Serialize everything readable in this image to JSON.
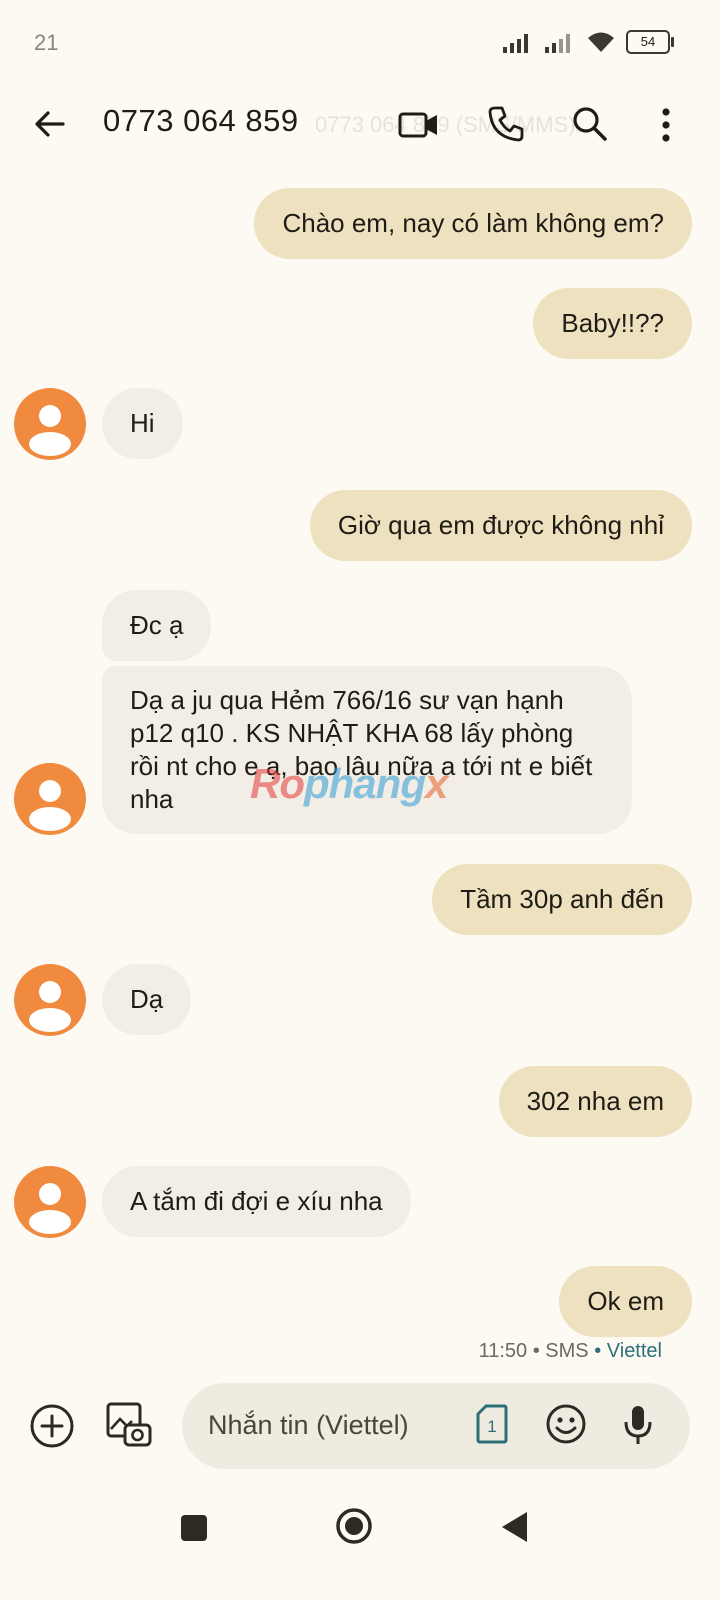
{
  "status_bar": {
    "time": "21",
    "battery": "54"
  },
  "header": {
    "back_icon": "arrow-left-icon",
    "title": "0773 064 859",
    "ghost_text": "0773 064 859 (SMS/MMS)",
    "actions": [
      "video-call-icon",
      "phone-icon",
      "search-icon",
      "more-vertical-icon"
    ]
  },
  "messages": [
    {
      "direction": "out",
      "text": "Chào em, nay có làm không em?"
    },
    {
      "direction": "out",
      "text": "Baby!!??"
    },
    {
      "direction": "in",
      "text": "Hi"
    },
    {
      "direction": "out",
      "text": "Giờ qua em được không nhỉ"
    },
    {
      "direction": "in",
      "text": "Đc ạ"
    },
    {
      "direction": "in",
      "text": "Dạ a ju qua Hẻm 766/16 sư vạn hạnh p12 q10 . KS NHẬT KHA 68 lấy phòng rồi nt cho e ạ, bao lâu nữa a tới nt e biết nha"
    },
    {
      "direction": "out",
      "text": "Tầm 30p anh đến"
    },
    {
      "direction": "in",
      "text": "Dạ"
    },
    {
      "direction": "out",
      "text": "302 nha em"
    },
    {
      "direction": "in",
      "text": "A tắm đi đợi e xíu nha"
    },
    {
      "direction": "out",
      "text": "Ok em"
    }
  ],
  "last_meta": {
    "time": "11:50",
    "type": "SMS",
    "carrier": "Viettel"
  },
  "watermark": {
    "part1": "Ro",
    "part2": "phang",
    "part3": "x"
  },
  "compose": {
    "placeholder": "Nhắn tin (Viettel)",
    "sim_label": "1",
    "icons": [
      "add-circle-icon",
      "gallery-camera-icon",
      "sim-card-icon",
      "emoji-icon",
      "mic-icon"
    ]
  },
  "nav": {
    "icons": [
      "recents-square-icon",
      "home-circle-icon",
      "back-triangle-icon"
    ]
  },
  "colors": {
    "background": "#FCFAF3",
    "outgoing_bubble": "#EEE1BF",
    "incoming_bubble": "#F2EEE5",
    "avatar": "#F08A3E",
    "carrier_accent": "#2D6F78"
  }
}
